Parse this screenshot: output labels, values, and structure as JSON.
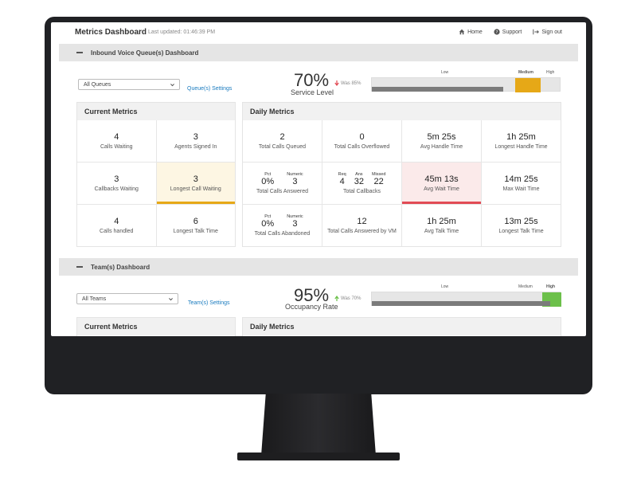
{
  "header": {
    "title": "Metrics Dashboard",
    "last_updated": "Last updated: 01:46:39 PM",
    "nav": {
      "home": "Home",
      "support": "Support",
      "signout": "Sign out"
    }
  },
  "queue": {
    "section_title": "Inbound Voice Queue(s) Dashboard",
    "select_value": "All Queues",
    "settings_link": "Queue(s) Settings",
    "kpi": {
      "value": "70%",
      "label": "Service Level",
      "was": "Was 85%",
      "trend": "down",
      "percent": 70
    },
    "thresholds": {
      "low": "Low",
      "medium": "Medium",
      "high": "High"
    },
    "current": {
      "title": "Current Metrics",
      "cells": [
        {
          "value": "4",
          "label": "Calls Waiting"
        },
        {
          "value": "3",
          "label": "Agents Signed In"
        },
        {
          "value": "3",
          "label": "Callbacks Waiting"
        },
        {
          "value": "3",
          "label": "Longest Call Waiting"
        },
        {
          "value": "4",
          "label": "Calls handled"
        },
        {
          "value": "6",
          "label": "Longest Talk Time"
        }
      ]
    },
    "daily": {
      "title": "Daily Metrics",
      "row1": [
        {
          "value": "2",
          "label": "Total Calls Queued"
        },
        {
          "value": "0",
          "label": "Total Calls Overflowed"
        },
        {
          "value": "5m 25s",
          "label": "Avg Handle Time"
        },
        {
          "value": "1h 25m",
          "label": "Longest Handle Time"
        }
      ],
      "answered": {
        "pct_label": "Pct",
        "pct": "0%",
        "num_label": "Numeric",
        "num": "3",
        "label": "Total Calls Answered"
      },
      "callbacks": {
        "req_label": "Req",
        "req": "4",
        "ans_label": "Ans",
        "ans": "32",
        "missed_label": "Missed",
        "missed": "22",
        "label": "Total Callbacks"
      },
      "avg_wait": {
        "value": "45m 13s",
        "label": "Avg Wait Time"
      },
      "max_wait": {
        "value": "14m 25s",
        "label": "Max Wait Time"
      },
      "abandoned": {
        "pct_label": "Pct",
        "pct": "0%",
        "num_label": "Numeric",
        "num": "3",
        "label": "Total Calls Abandoned"
      },
      "row3": [
        {
          "value": "12",
          "label": "Total Calls Answered by VM"
        },
        {
          "value": "1h 25m",
          "label": "Avg Talk Time"
        },
        {
          "value": "13m 25s",
          "label": "Longest Talk Time"
        }
      ]
    }
  },
  "team": {
    "section_title": "Team(s) Dashboard",
    "select_value": "All Teams",
    "settings_link": "Team(s) Settings",
    "kpi": {
      "value": "95%",
      "label": "Occupancy Rate",
      "was": "Was 70%",
      "trend": "up",
      "percent": 95
    },
    "thresholds": {
      "low": "Low",
      "medium": "Medium",
      "high": "High"
    },
    "current_title": "Current Metrics",
    "daily_title": "Daily Metrics"
  },
  "colors": {
    "medium_zone": "#e6a817",
    "high_zone": "#6cc04a",
    "alert": "#e24b55",
    "link": "#1a7bbf",
    "trend_down": "#e24b55",
    "trend_up": "#6cc04a"
  }
}
